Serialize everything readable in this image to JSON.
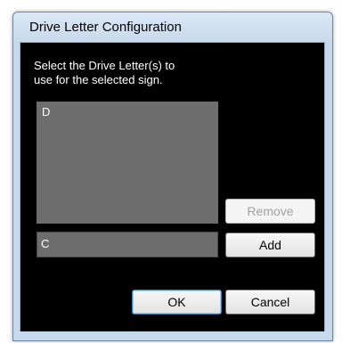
{
  "window": {
    "title": "Drive Letter Configuration"
  },
  "instruction": "Select the Drive Letter(s) to\nuse for the selected sign.",
  "listbox": {
    "items": [
      "D"
    ]
  },
  "input": {
    "value": "C"
  },
  "buttons": {
    "remove": "Remove",
    "add": "Add",
    "ok": "OK",
    "cancel": "Cancel"
  },
  "colors": {
    "client_background": "#000000",
    "field_background": "#6d6d6d",
    "frame": "#c7d9ec"
  }
}
